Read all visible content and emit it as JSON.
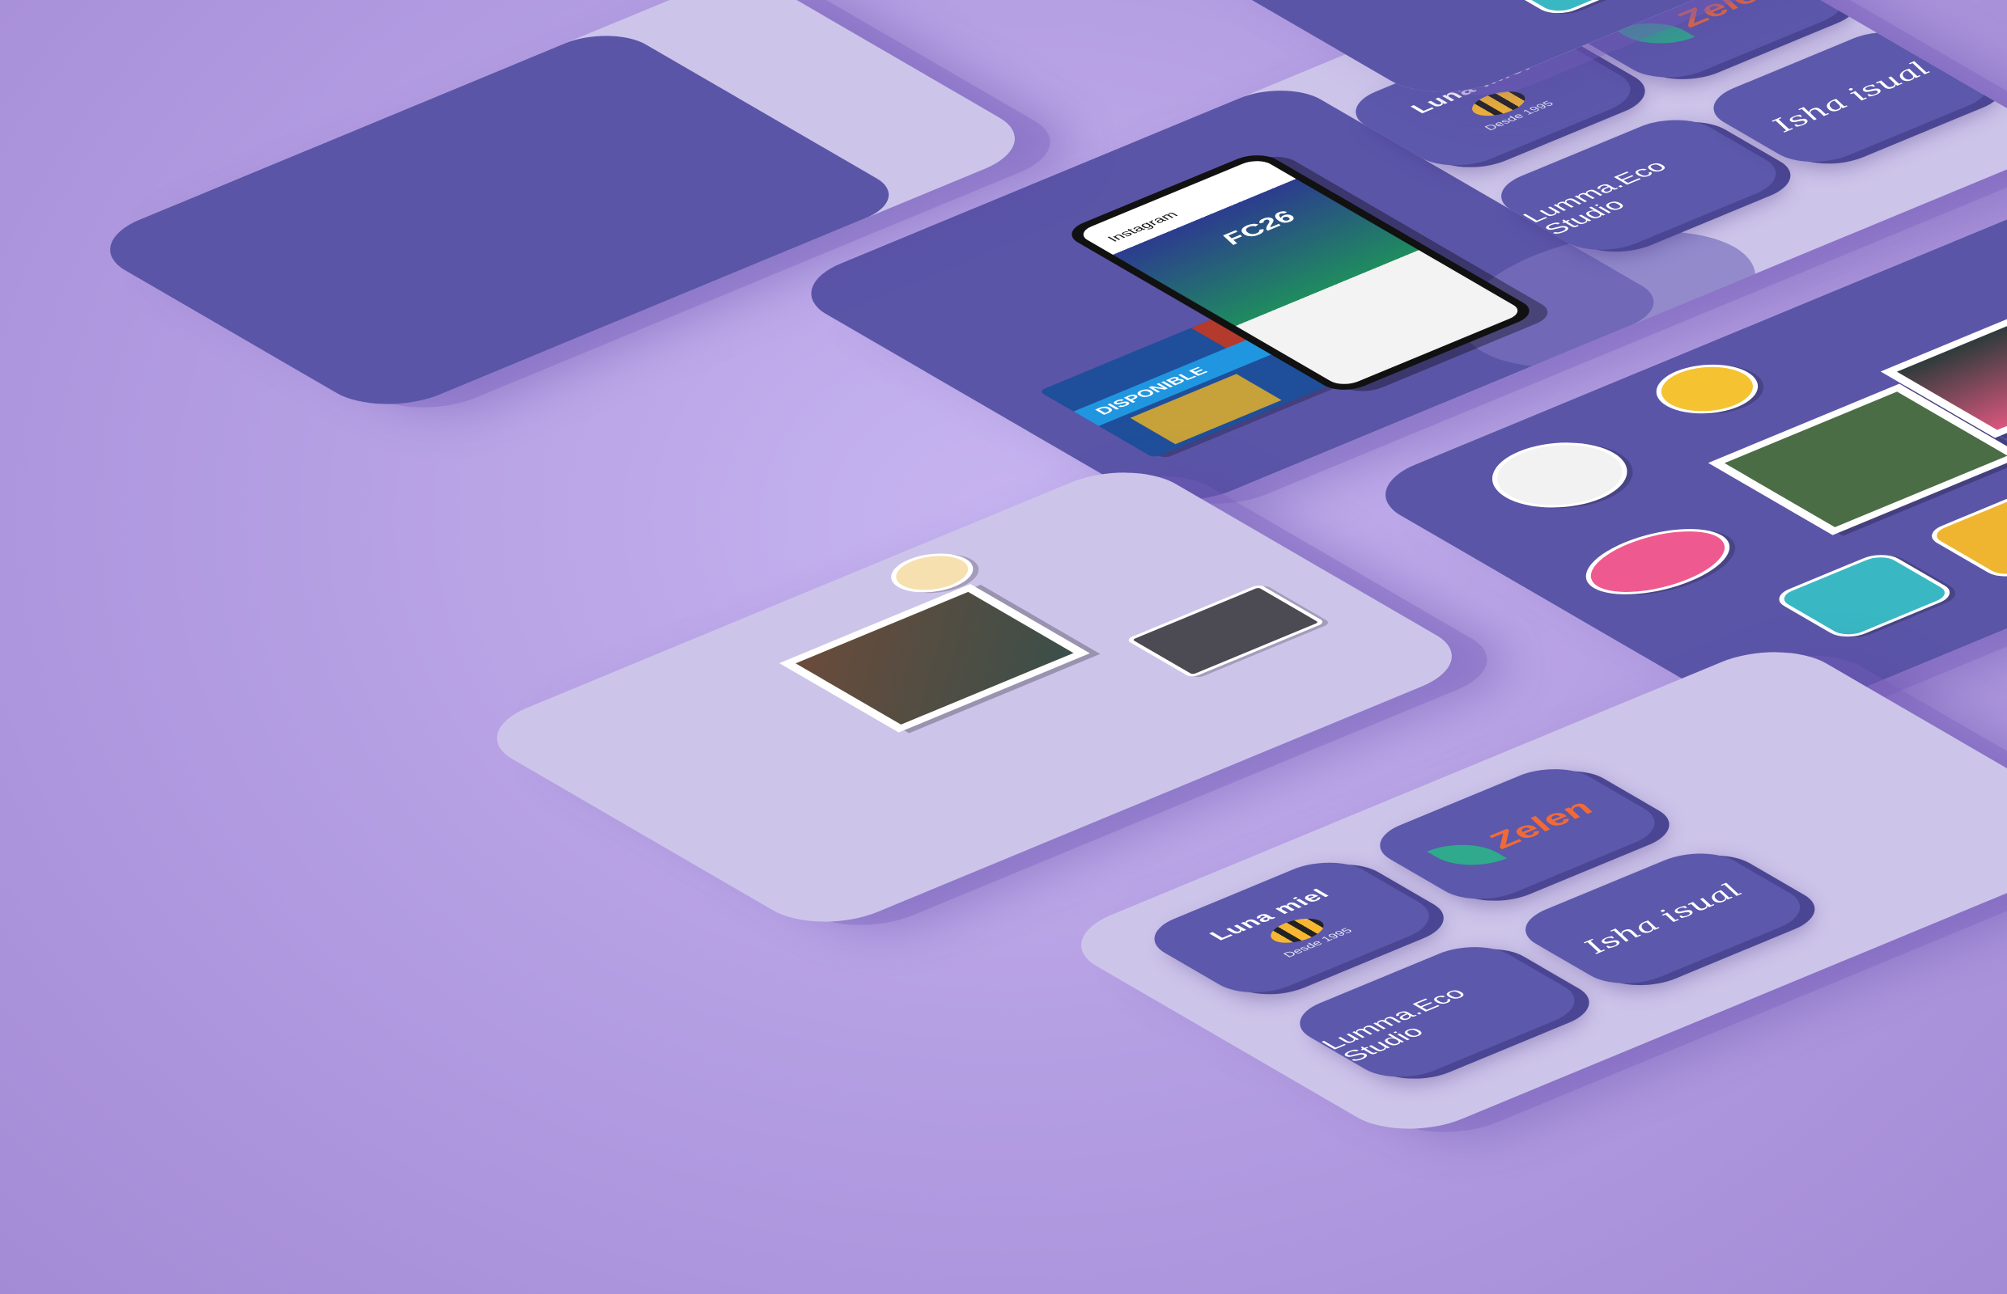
{
  "tiles": {
    "luna_title": "Luna miel",
    "luna_sub": "Desde 1995",
    "zelen": "Zelen",
    "lumma": "Lumma.Eco Studio",
    "isha": "Isha isual"
  },
  "phone": {
    "app": "Instagram",
    "game": "FC26"
  },
  "promo": {
    "badge": "DISPONIBLE"
  },
  "colors": {
    "background": "#b7a3e6",
    "board": "#cdc4ea",
    "tile": "#5c58ab",
    "accent_orange": "#f06a38",
    "leaf_green": "#2faa8c"
  }
}
